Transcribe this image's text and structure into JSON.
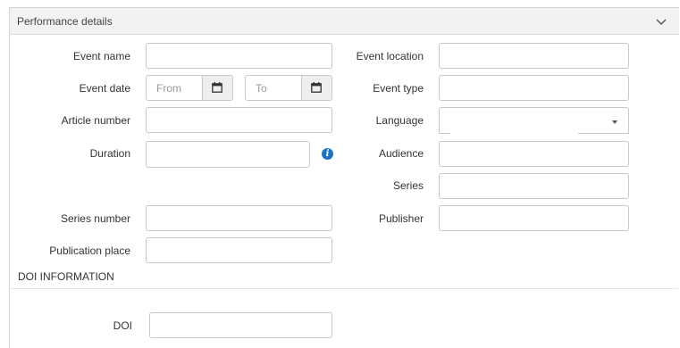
{
  "panel": {
    "title": "Performance details",
    "collapse_icon": "chevron-down-icon"
  },
  "fields": {
    "event_name": {
      "label": "Event name",
      "value": ""
    },
    "event_location": {
      "label": "Event location",
      "value": ""
    },
    "event_date": {
      "label": "Event date",
      "from_placeholder": "From",
      "to_placeholder": "To",
      "calendar_icon": "calendar-icon"
    },
    "event_type": {
      "label": "Event type",
      "value": ""
    },
    "article_number": {
      "label": "Article number",
      "value": ""
    },
    "language": {
      "label": "Language",
      "selected": ""
    },
    "duration": {
      "label": "Duration",
      "value": "",
      "info_icon": "info-icon"
    },
    "audience": {
      "label": "Audience",
      "value": ""
    },
    "series": {
      "label": "Series",
      "value": ""
    },
    "series_number": {
      "label": "Series number",
      "value": ""
    },
    "publisher": {
      "label": "Publisher",
      "value": ""
    },
    "publication_place": {
      "label": "Publication place",
      "value": ""
    }
  },
  "doi_section": {
    "title": "DOI INFORMATION",
    "doi": {
      "label": "DOI",
      "value": ""
    }
  },
  "colors": {
    "header_bg": "#f2f2f2",
    "border": "#c8c8c8",
    "info_icon": "#1a73c8"
  }
}
